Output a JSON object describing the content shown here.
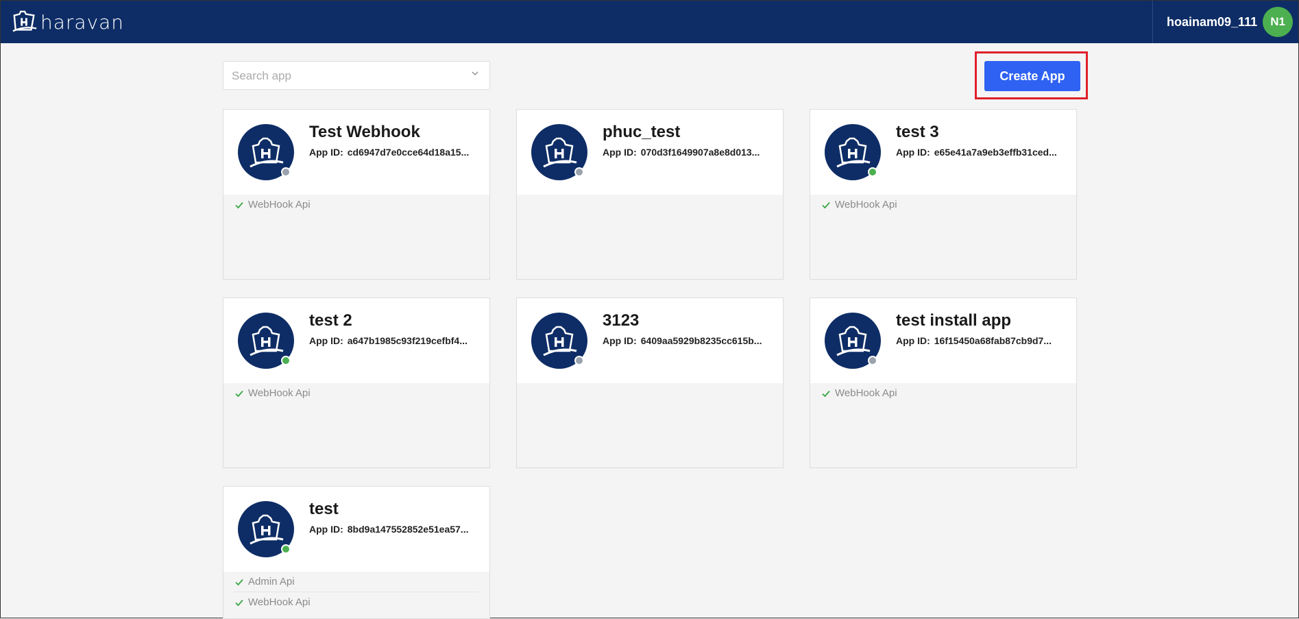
{
  "header": {
    "logo_text": "haravan",
    "username": "hoainam09_111",
    "avatar_initials": "N1"
  },
  "search": {
    "placeholder": "Search app",
    "value": ""
  },
  "create_button": {
    "label": "Create App"
  },
  "colors": {
    "header_bg": "#0e2d66",
    "primary": "#2f62f2",
    "status_active": "#4caf50",
    "status_inactive": "#9aa3ad",
    "highlight": "#e0202a"
  },
  "apps": [
    {
      "name": "Test Webhook",
      "id_label": "App ID:",
      "id": "cd6947d7e0cce64d18a15...",
      "status": "inactive",
      "permissions": [
        "WebHook Api"
      ]
    },
    {
      "name": "phuc_test",
      "id_label": "App ID:",
      "id": "070d3f1649907a8e8d013...",
      "status": "inactive",
      "permissions": []
    },
    {
      "name": "test 3",
      "id_label": "App ID:",
      "id": "e65e41a7a9eb3effb31ced...",
      "status": "active",
      "permissions": [
        "WebHook Api"
      ]
    },
    {
      "name": "test 2",
      "id_label": "App ID:",
      "id": "a647b1985c93f219cefbf4...",
      "status": "active",
      "permissions": [
        "WebHook Api"
      ]
    },
    {
      "name": "3123",
      "id_label": "App ID:",
      "id": "6409aa5929b8235cc615b...",
      "status": "inactive",
      "permissions": []
    },
    {
      "name": "test install app",
      "id_label": "App ID:",
      "id": "16f15450a68fab87cb9d7...",
      "status": "inactive",
      "permissions": [
        "WebHook Api"
      ]
    },
    {
      "name": "test",
      "id_label": "App ID:",
      "id": "8bd9a147552852e51ea57...",
      "status": "active",
      "permissions": [
        "Admin Api",
        "WebHook Api"
      ]
    }
  ]
}
